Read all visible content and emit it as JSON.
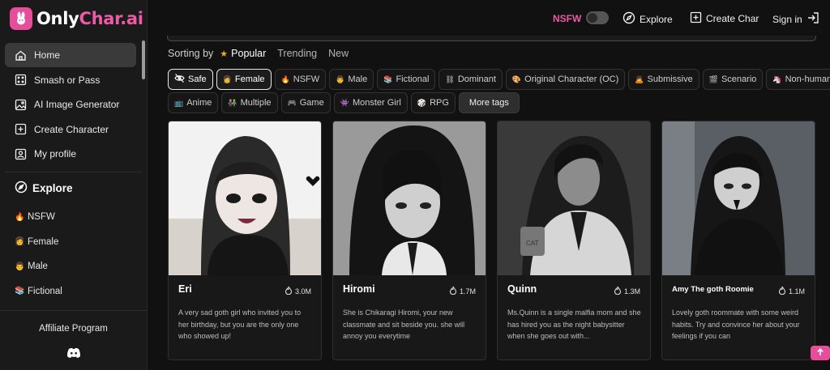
{
  "brand": {
    "name_part1": "Only",
    "name_part2": "Char.ai",
    "accent_color": "#e64d9a"
  },
  "header": {
    "nsfw_label": "NSFW",
    "nsfw_enabled": false,
    "explore_label": "Explore",
    "create_label": "Create Char",
    "signin_label": "Sign in"
  },
  "sidebar": {
    "items": [
      {
        "label": "Home",
        "icon": "home-icon",
        "active": true
      },
      {
        "label": "Smash or Pass",
        "icon": "grid-icon"
      },
      {
        "label": "AI Image Generator",
        "icon": "image-icon"
      },
      {
        "label": "Create Character",
        "icon": "plus-square-icon"
      },
      {
        "label": "My profile",
        "icon": "user-icon"
      }
    ],
    "explore_label": "Explore",
    "categories": [
      {
        "emoji": "🔥",
        "label": "NSFW"
      },
      {
        "emoji": "👩",
        "label": "Female"
      },
      {
        "emoji": "👨",
        "label": "Male"
      },
      {
        "emoji": "📚",
        "label": "Fictional"
      }
    ],
    "affiliate_label": "Affiliate Program"
  },
  "sorting": {
    "label": "Sorting by",
    "options": [
      "Popular",
      "Trending",
      "New"
    ],
    "selected": "Popular"
  },
  "tags_row1": [
    {
      "emoji": "",
      "label": "Safe",
      "selected": true
    },
    {
      "emoji": "👩",
      "label": "Female",
      "selected": true
    },
    {
      "emoji": "🔥",
      "label": "NSFW"
    },
    {
      "emoji": "👨",
      "label": "Male"
    },
    {
      "emoji": "📚",
      "label": "Fictional"
    },
    {
      "emoji": "⛓",
      "label": "Dominant"
    },
    {
      "emoji": "🎨",
      "label": "Original Character (OC)"
    },
    {
      "emoji": "🙇",
      "label": "Submissive"
    },
    {
      "emoji": "🎬",
      "label": "Scenario"
    },
    {
      "emoji": "🦄",
      "label": "Non-human"
    }
  ],
  "tags_row2": [
    {
      "emoji": "📺",
      "label": "Anime"
    },
    {
      "emoji": "👫",
      "label": "Multiple"
    },
    {
      "emoji": "🎮",
      "label": "Game"
    },
    {
      "emoji": "👾",
      "label": "Monster Girl"
    },
    {
      "emoji": "🎲",
      "label": "RPG"
    }
  ],
  "more_tags_label": "More tags",
  "cards": [
    {
      "name": "Eri",
      "count": "3.0M",
      "desc": "A very sad goth girl who invited you to her birthday, but you are the only one who showed up!"
    },
    {
      "name": "Hiromi",
      "count": "1.7M",
      "desc": "She is Chikaragi Hiromi, your new classmate and sit beside you. she will annoy you everytime"
    },
    {
      "name": "Quinn",
      "count": "1.3M",
      "desc": "Ms.Quinn is a single malfia mom and she has hired you as the night babysitter when she goes out with..."
    },
    {
      "name": "Amy The goth Roomie",
      "count": "1.1M",
      "desc": "Lovely goth roommate with some weird habits. Try and convince her about your feelings if you can"
    }
  ]
}
